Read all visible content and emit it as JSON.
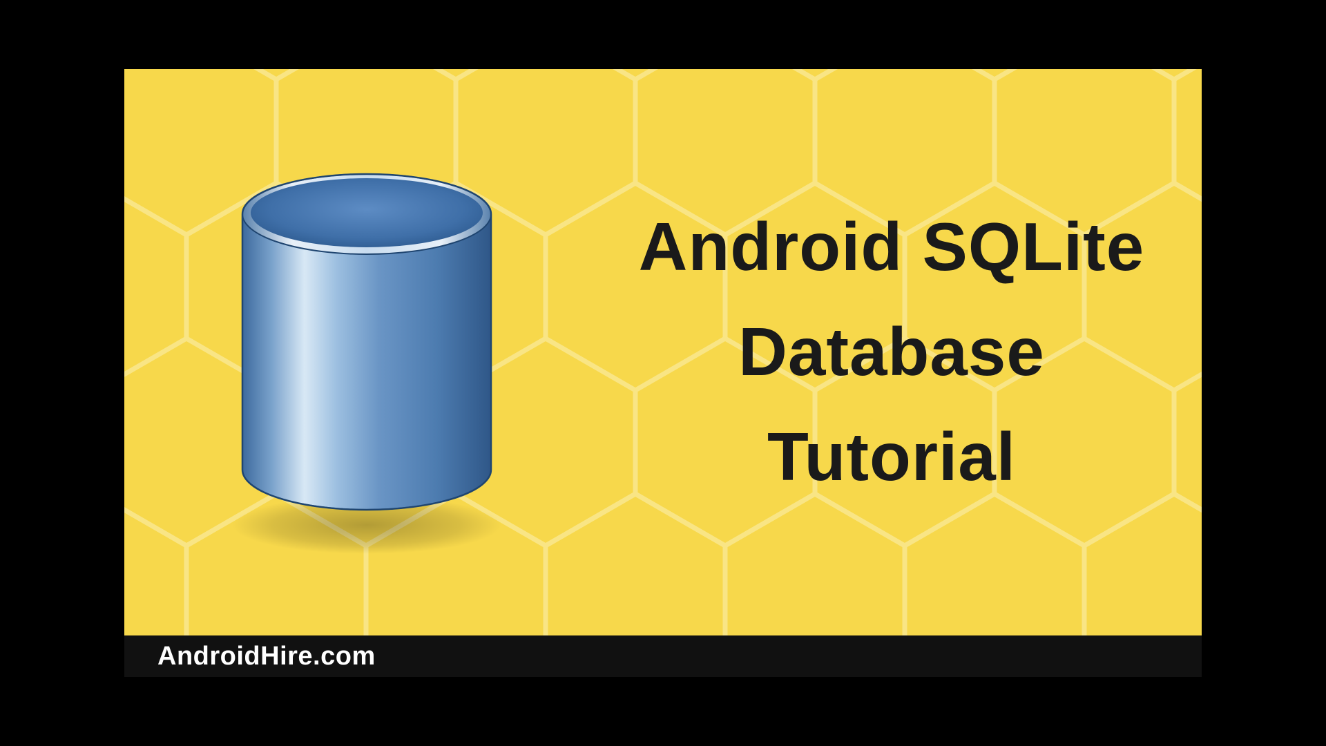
{
  "title": {
    "line1": "Android SQLite",
    "line2": "Database",
    "line3": "Tutorial"
  },
  "footer": {
    "site": "AndroidHire.com"
  },
  "colors": {
    "background": "#f7d84b",
    "hexLine": "#f9e585",
    "text": "#1a1a1a",
    "footerBg": "#111111",
    "footerText": "#ffffff",
    "dbTop": "#4a7bb5",
    "dbSide": "#5a8bc9",
    "dbHighlight": "#d8e6f2"
  }
}
